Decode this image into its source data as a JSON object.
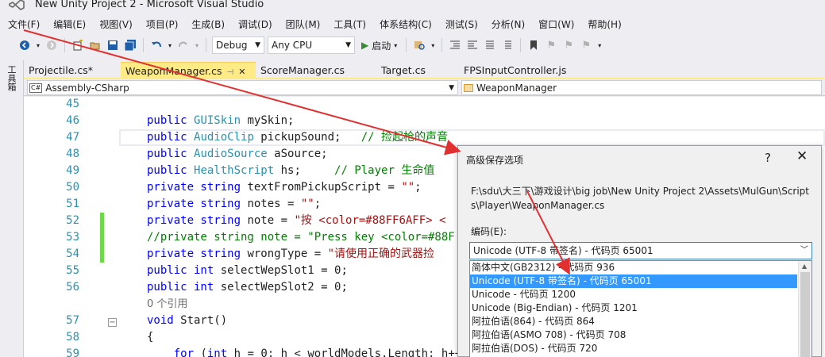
{
  "window": {
    "title": "New Unity Project 2 - Microsoft Visual Studio"
  },
  "menu": [
    "文件(F)",
    "编辑(E)",
    "视图(V)",
    "项目(P)",
    "生成(B)",
    "调试(D)",
    "团队(M)",
    "工具(T)",
    "体系结构(C)",
    "测试(S)",
    "分析(N)",
    "窗口(W)",
    "帮助(H)"
  ],
  "toolbar": {
    "config": "Debug",
    "platform": "Any CPU",
    "start_label": "启动"
  },
  "toolbox": {
    "label": "工具箱"
  },
  "tabs": [
    {
      "label": "Projectile.cs*"
    },
    {
      "label": "WeaponManager.cs"
    },
    {
      "label": "ScoreManager.cs"
    },
    {
      "label": "Target.cs"
    },
    {
      "label": "FPSInputController.js"
    }
  ],
  "navbar": {
    "project": "Assembly-CSharp",
    "class": "WeaponManager"
  },
  "code": {
    "l45": "45",
    "l46": "46",
    "t46a": "public ",
    "t46b": "GUISkin",
    "t46c": " mySkin;",
    "l47": "47",
    "t47a": "public ",
    "t47b": "AudioClip",
    "t47c": " pickupSound;   ",
    "t47d": "// 捡起枪的声音",
    "l48": "48",
    "t48a": "public ",
    "t48b": "AudioSource",
    "t48c": " aSource;",
    "l49": "49",
    "t49a": "public ",
    "t49b": "HealthScript",
    "t49c": " hs;     ",
    "t49d": "// Player 生命值",
    "l50": "50",
    "t50a": "private string",
    "t50b": " textFromPickupScript = ",
    "t50c": "\"\"",
    "t50d": ";",
    "l51": "51",
    "t51a": "private string",
    "t51b": " notes = ",
    "t51c": "\"\"",
    "t51d": ";",
    "l52": "52",
    "t52a": "private string",
    "t52b": " note = ",
    "t52c": "\"按 <color=#88FF6AFF> <",
    "l53": "53",
    "t53": "//private string note = \"Press key <color=#88F",
    "l54": "54",
    "t54a": "private string",
    "t54b": " wrongType = ",
    "t54c": "\"请使用正确的武器捡",
    "l55": "55",
    "t55a": "public int",
    "t55b": " selectWepSlot1 = 0;",
    "l56": "56",
    "t56a": "public int",
    "t56b": " selectWepSlot2 = 0;",
    "refs": "0 个引用",
    "l57": "57",
    "t57a": "void",
    "t57b": " Start()",
    "l58": "58",
    "t58": "{",
    "l59": "59",
    "t59a": "for",
    "t59b": " (",
    "t59c": "int",
    "t59d": " h = 0; h < worldModels.Length; h++"
  },
  "dialog": {
    "title": "高级保存选项",
    "help": "?",
    "close": "✕",
    "path": "F:\\sdu\\大三下\\游戏设计\\big job\\New Unity Project 2\\Assets\\MulGun\\Scripts\\Player\\WeaponManager.cs",
    "encoding_label": "编码(E):",
    "selected": "Unicode (UTF-8 带签名) - 代码页 65001",
    "options": [
      "简体中文(GB2312) - 代码页 936",
      "Unicode (UTF-8 带签名) - 代码页 65001",
      "Unicode - 代码页 1200",
      "Unicode (Big-Endian) - 代码页 1201",
      "阿拉伯语(864) - 代码页 864",
      "阿拉伯语(ASMO 708) - 代码页 708",
      "阿拉伯语(DOS) - 代码页 720"
    ]
  },
  "colors": {
    "annotation_arrow": "#e03030",
    "active_tab": "#ffeb85",
    "selection": "#3399ff"
  }
}
